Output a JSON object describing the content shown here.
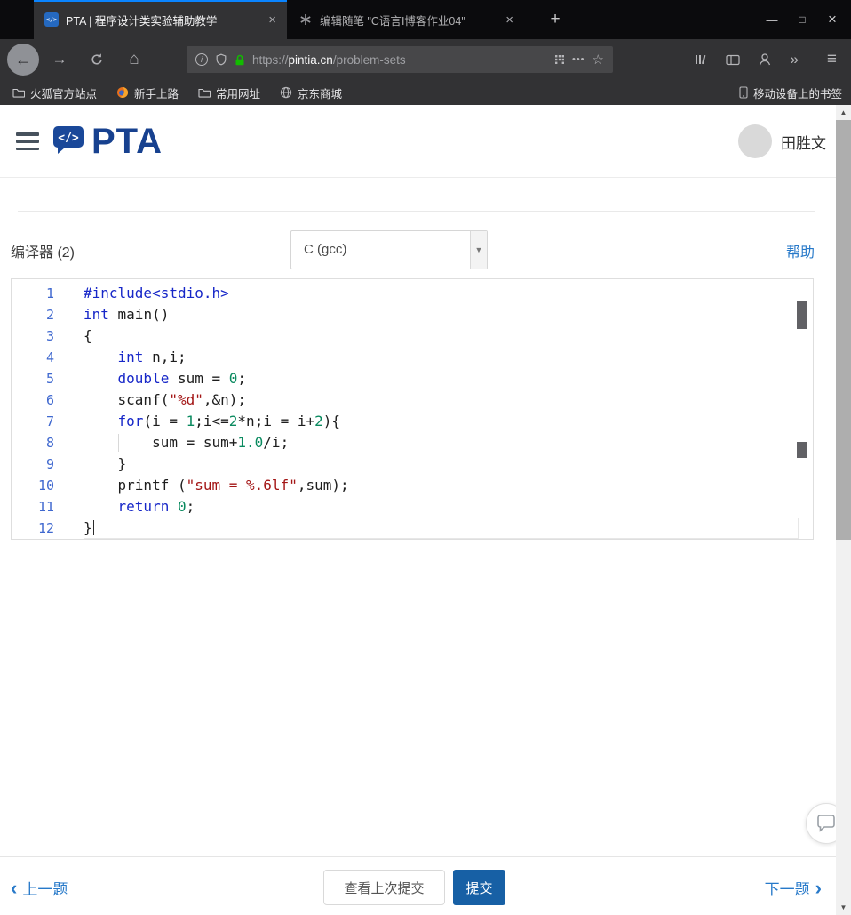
{
  "colors": {
    "tab_accent": "#0a84ff",
    "chrome_dark": "#0b0b0d",
    "toolbar_dark": "#323234",
    "lock_green": "#12bc00",
    "brand_blue": "#17418f",
    "link_blue": "#2779c9",
    "submit_blue": "#1760a5",
    "keyword": "#1727c8",
    "string": "#a31515",
    "number": "#0a8a5f"
  },
  "glyphs": {
    "back": "←",
    "forward": "→",
    "home": "⌂",
    "menu": "≡",
    "more": "»",
    "star": "☆",
    "dots": "•••",
    "info": "i",
    "minimize": "—",
    "maximize": "□",
    "close": "×",
    "tab_close": "×",
    "new_tab": "+",
    "select_arrow": "▼",
    "scroll_up": "▲",
    "scroll_down": "▼",
    "prev": "‹",
    "next": "›"
  },
  "chrome": {
    "tabs": [
      {
        "title": "PTA | 程序设计类实验辅助教学",
        "active": true
      },
      {
        "title": "编辑随笔 \"C语言I博客作业04\"",
        "active": false
      }
    ],
    "url": {
      "scheme": "https://",
      "domain": "pintia.cn",
      "path": "/problem-sets"
    },
    "bookmarks": [
      {
        "label": "火狐官方站点",
        "icon": "folder-icon"
      },
      {
        "label": "新手上路",
        "icon": "firefox-icon"
      },
      {
        "label": "常用网址",
        "icon": "folder-icon"
      },
      {
        "label": "京东商城",
        "icon": "globe-icon"
      }
    ],
    "bookmarks_right": "移动设备上的书签"
  },
  "site": {
    "brand": "PTA",
    "logo_code": "</>",
    "user_name": "田胜文"
  },
  "compiler": {
    "label": "编译器 (2)",
    "selected": "C (gcc)",
    "help": "帮助"
  },
  "editor": {
    "language": "C",
    "lines": [
      {
        "n": 1,
        "tokens": [
          {
            "c": "k",
            "t": "#include<stdio.h>"
          }
        ]
      },
      {
        "n": 2,
        "tokens": [
          {
            "c": "k",
            "t": "int"
          },
          {
            "c": "p",
            "t": " main()"
          }
        ]
      },
      {
        "n": 3,
        "tokens": [
          {
            "c": "p",
            "t": "{"
          }
        ]
      },
      {
        "n": 4,
        "tokens": [
          {
            "c": "p",
            "t": "    "
          },
          {
            "c": "k",
            "t": "int"
          },
          {
            "c": "p",
            "t": " n,i;"
          }
        ]
      },
      {
        "n": 5,
        "tokens": [
          {
            "c": "p",
            "t": "    "
          },
          {
            "c": "k",
            "t": "double"
          },
          {
            "c": "p",
            "t": " sum = "
          },
          {
            "c": "n",
            "t": "0"
          },
          {
            "c": "p",
            "t": ";"
          }
        ]
      },
      {
        "n": 6,
        "tokens": [
          {
            "c": "p",
            "t": "    scanf("
          },
          {
            "c": "s",
            "t": "\"%d\""
          },
          {
            "c": "p",
            "t": ",&n);"
          }
        ]
      },
      {
        "n": 7,
        "tokens": [
          {
            "c": "p",
            "t": "    "
          },
          {
            "c": "k",
            "t": "for"
          },
          {
            "c": "p",
            "t": "(i = "
          },
          {
            "c": "n",
            "t": "1"
          },
          {
            "c": "p",
            "t": ";i<="
          },
          {
            "c": "n",
            "t": "2"
          },
          {
            "c": "p",
            "t": "*n;i = i+"
          },
          {
            "c": "n",
            "t": "2"
          },
          {
            "c": "p",
            "t": "){"
          }
        ]
      },
      {
        "n": 8,
        "guide": true,
        "tokens": [
          {
            "c": "p",
            "t": "        sum = sum+"
          },
          {
            "c": "n",
            "t": "1.0"
          },
          {
            "c": "p",
            "t": "/i;"
          }
        ]
      },
      {
        "n": 9,
        "tokens": [
          {
            "c": "p",
            "t": "    }"
          }
        ]
      },
      {
        "n": 10,
        "tokens": [
          {
            "c": "p",
            "t": "    printf ("
          },
          {
            "c": "s",
            "t": "\"sum = %.6lf\""
          },
          {
            "c": "p",
            "t": ",sum);"
          }
        ]
      },
      {
        "n": 11,
        "tokens": [
          {
            "c": "p",
            "t": "    "
          },
          {
            "c": "k",
            "t": "return"
          },
          {
            "c": "p",
            "t": " "
          },
          {
            "c": "n",
            "t": "0"
          },
          {
            "c": "p",
            "t": ";"
          }
        ]
      },
      {
        "n": 12,
        "active": true,
        "caret": true,
        "tokens": [
          {
            "c": "p",
            "t": "}"
          }
        ]
      }
    ]
  },
  "footer": {
    "prev": "上一题",
    "next": "下一题",
    "view_last_submit": "查看上次提交",
    "submit": "提交"
  }
}
